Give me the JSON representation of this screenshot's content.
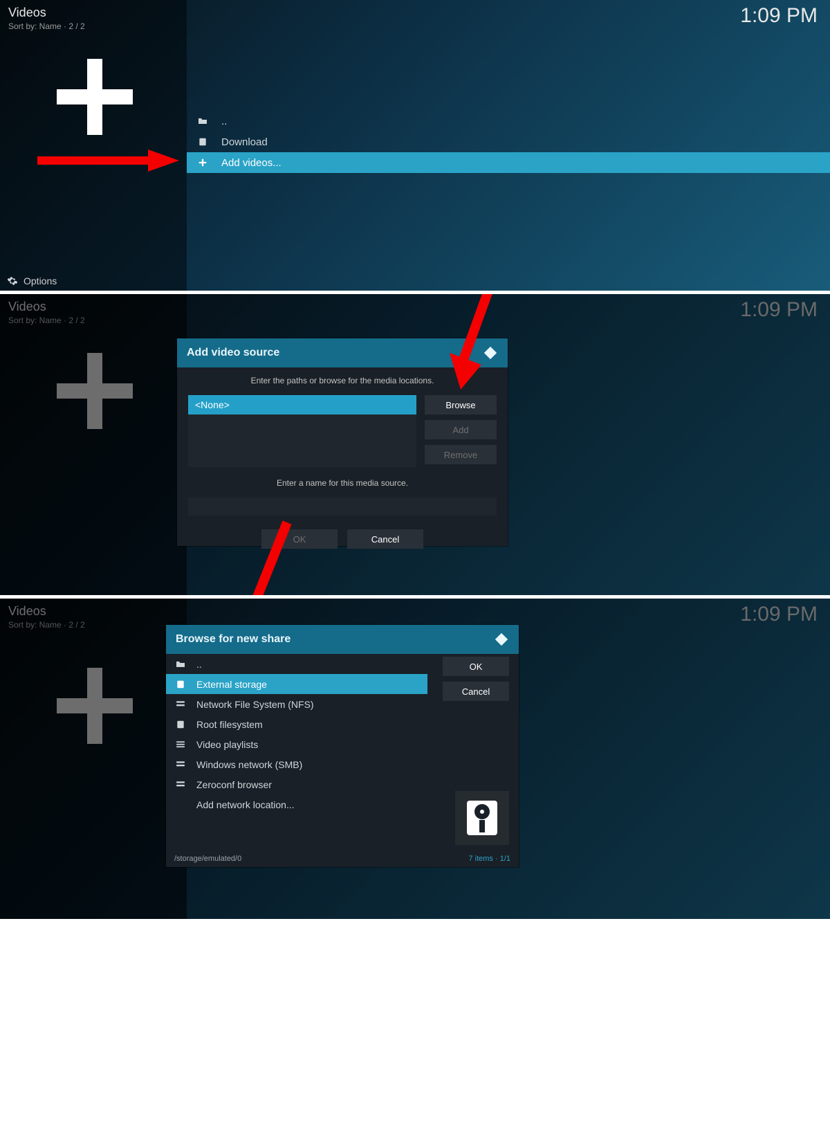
{
  "header": {
    "title": "Videos",
    "sort_label": "Sort by: Name  ·  2 / 2",
    "clock": "1:09 PM",
    "options_label": "Options"
  },
  "panel1": {
    "rows": [
      {
        "icon": "folder-up-icon",
        "label": ".."
      },
      {
        "icon": "device-icon",
        "label": "Download"
      },
      {
        "icon": "plus-icon",
        "label": "Add videos...",
        "selected": true
      }
    ]
  },
  "panel2": {
    "dialog_title": "Add video source",
    "instruction": "Enter the paths or browse for the media locations.",
    "path_value": "<None>",
    "browse_label": "Browse",
    "add_label": "Add",
    "remove_label": "Remove",
    "name_instruction": "Enter a name for this media source.",
    "ok_label": "OK",
    "cancel_label": "Cancel"
  },
  "panel3": {
    "dialog_title": "Browse for new share",
    "ok_label": "OK",
    "cancel_label": "Cancel",
    "rows": [
      {
        "icon": "folder-up-icon",
        "label": ".."
      },
      {
        "icon": "device-icon",
        "label": "External storage",
        "selected": true
      },
      {
        "icon": "net-icon",
        "label": "Network File System (NFS)"
      },
      {
        "icon": "device-icon",
        "label": "Root filesystem"
      },
      {
        "icon": "list-icon",
        "label": "Video playlists"
      },
      {
        "icon": "net-icon",
        "label": "Windows network (SMB)"
      },
      {
        "icon": "net-icon",
        "label": "Zeroconf browser"
      },
      {
        "icon": "",
        "label": "Add network location..."
      }
    ],
    "path": "/storage/emulated/0",
    "footer_items": "7 items · 1/1"
  }
}
